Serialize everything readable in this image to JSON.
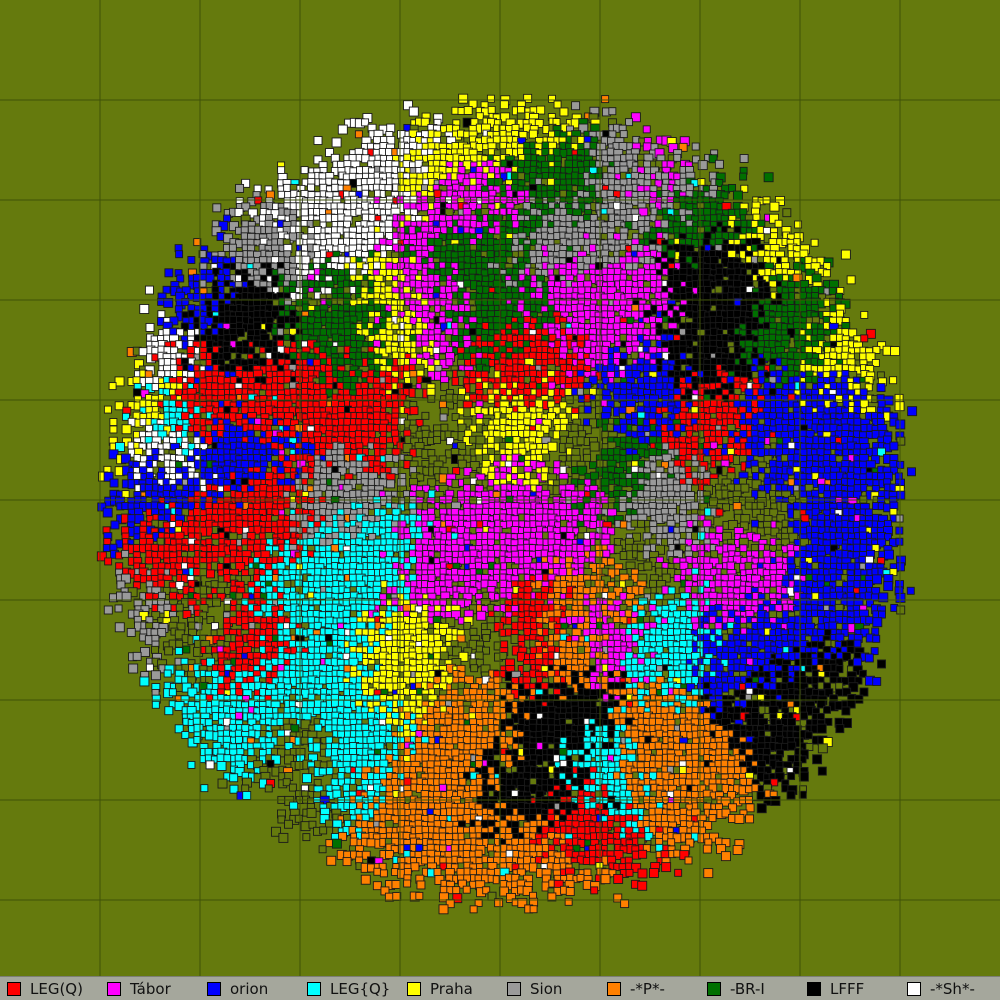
{
  "map": {
    "background_color": "#657a0d",
    "grid_color": "#3f5208",
    "tile_outline_color": "#1a1a1a"
  },
  "legend": {
    "items": [
      {
        "label": "LEG(Q)",
        "color": "#ff0000"
      },
      {
        "label": "Tábor",
        "color": "#ff00ff"
      },
      {
        "label": "orion",
        "color": "#0000ff"
      },
      {
        "label": "LEG{Q}",
        "color": "#00ffff"
      },
      {
        "label": "Praha",
        "color": "#ffff00"
      },
      {
        "label": "Sion",
        "color": "#9a9a9a"
      },
      {
        "label": "-*P*-",
        "color": "#ff8000"
      },
      {
        "label": "-BR-I",
        "color": "#007000"
      },
      {
        "label": "LFFF",
        "color": "#000000"
      },
      {
        "label": "-*Sh*-",
        "color": "#ffffff"
      }
    ]
  }
}
